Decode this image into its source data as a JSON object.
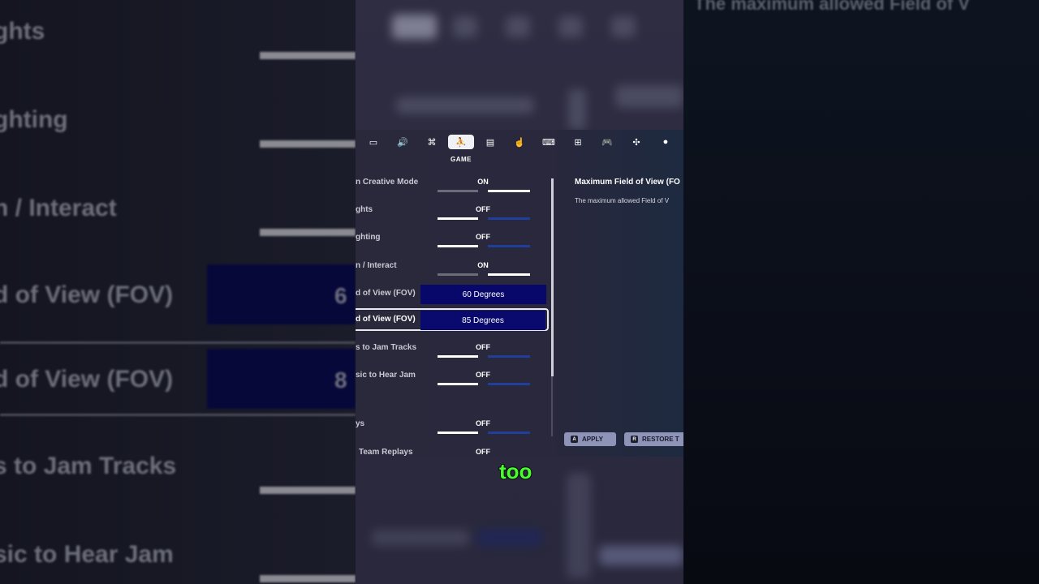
{
  "tabs": [
    {
      "icon": "monitor-icon",
      "glyph": "▭"
    },
    {
      "icon": "speaker-icon",
      "glyph": "🔊"
    },
    {
      "icon": "accessibility-icon",
      "glyph": "⌘"
    },
    {
      "icon": "game-controller-user-icon",
      "glyph": "⛹"
    },
    {
      "icon": "keyboard-card-icon",
      "glyph": "▤"
    },
    {
      "icon": "touch-icon",
      "glyph": "☝"
    },
    {
      "icon": "mouse-keyboard-icon",
      "glyph": "⌨"
    },
    {
      "icon": "network-icon",
      "glyph": "⊞"
    },
    {
      "icon": "gamepad-icon",
      "glyph": "🎮"
    },
    {
      "icon": "wireless-controller-icon",
      "glyph": "✣"
    },
    {
      "icon": "account-icon",
      "glyph": "●"
    }
  ],
  "active_tab_title": "GAME",
  "settings": [
    {
      "label": "n Creative Mode",
      "value": "ON"
    },
    {
      "label": "ghts",
      "value": "OFF"
    },
    {
      "label": "ghting",
      "value": "OFF"
    },
    {
      "label": "n / Interact",
      "value": "ON"
    },
    {
      "label": "d of View (FOV)",
      "value": "60 Degrees"
    },
    {
      "label": "d of View (FOV)",
      "value": "85 Degrees"
    },
    {
      "label": "s to Jam Tracks",
      "value": "OFF"
    },
    {
      "label": "sic to Hear Jam",
      "value": "OFF"
    },
    {
      "label": "ys",
      "value": "OFF"
    },
    {
      "label": "Team Replays",
      "value": "OFF"
    }
  ],
  "description": {
    "title": "Maximum Field of View (FO",
    "text": "The maximum allowed Field of V"
  },
  "buttons": {
    "apply_key": "A",
    "apply": "APPLY",
    "restore_key": "R",
    "restore": "RESTORE T"
  },
  "background_left": {
    "labels": [
      "ghts",
      "ghting",
      "n / Interact",
      "d of View (FOV)",
      "d of View (FOV)",
      "s to Jam Tracks",
      "sic to Hear Jam"
    ],
    "fov_values": [
      "6",
      "8"
    ]
  },
  "background_right_title": "The maximum allowed Field of V",
  "caption": "too",
  "colors": {
    "caption": "#47ff2e",
    "fov_selected": "#07086a",
    "toggle_off_track": "#1f3f9a"
  }
}
